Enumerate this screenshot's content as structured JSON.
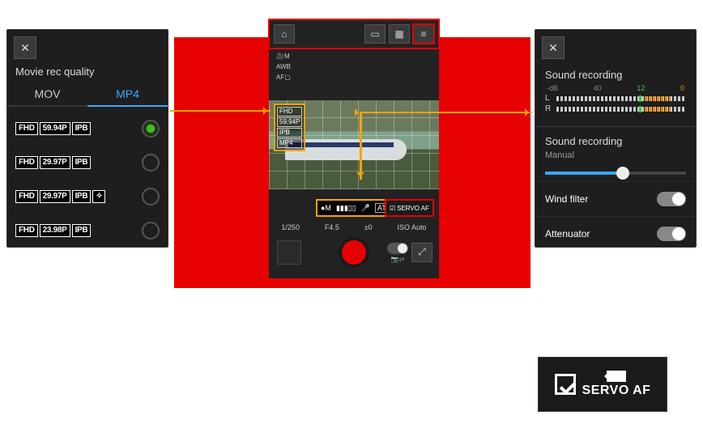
{
  "left_panel": {
    "title": "Movie rec quality",
    "tabs": {
      "mov": "MOV",
      "mp4": "MP4",
      "active": "mp4"
    },
    "options": [
      {
        "res": "FHD",
        "fps": "59.94P",
        "codec": "IPB",
        "extra": "",
        "selected": true
      },
      {
        "res": "FHD",
        "fps": "29.97P",
        "codec": "IPB",
        "extra": "",
        "selected": false
      },
      {
        "res": "FHD",
        "fps": "29.97P",
        "codec": "IPB",
        "extra": "light",
        "selected": false
      },
      {
        "res": "FHD",
        "fps": "23.98P",
        "codec": "IPB",
        "extra": "",
        "selected": false
      }
    ]
  },
  "center_panel": {
    "side_badges": {
      "mode": "M",
      "wb": "AWB",
      "af": "AF▢"
    },
    "quality_stack": [
      "FHD",
      "59.94P",
      "IPB",
      "MP4"
    ],
    "audio_strip": {
      "mic": "●M",
      "level": "▮▮▮▯▯",
      "mic_ic": "🎤",
      "att": "ATT"
    },
    "servo_small": "SERVO AF",
    "exposure": {
      "shutter": "1/250",
      "aperture": "F4.5",
      "ev": "±0",
      "iso_label": "ISO",
      "iso": "Auto"
    }
  },
  "right_panel": {
    "title": "Sound recording",
    "meter": {
      "db_label": "-dB",
      "left_val": "40",
      "mid_val": "12",
      "right_val": "0",
      "ch_l": "L",
      "ch_r": "R"
    },
    "section2_title": "Sound recording",
    "mode": "Manual",
    "toggles": {
      "wind": "Wind filter",
      "atten": "Attenuator"
    }
  },
  "servo_detail": {
    "label": "SERVO AF"
  }
}
